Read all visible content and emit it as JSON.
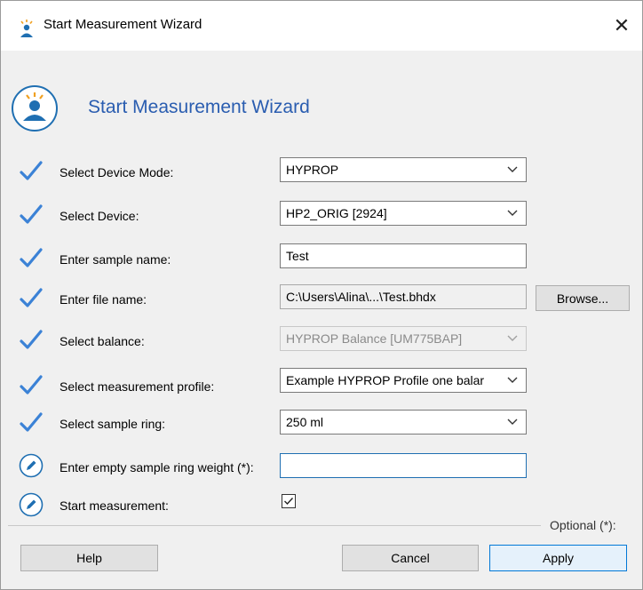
{
  "window": {
    "title": "Start Measurement Wizard",
    "close_glyph": "✕"
  },
  "header": {
    "title": "Start Measurement Wizard",
    "icon": "person-signal-icon"
  },
  "rows": [
    {
      "status": "done",
      "label": "Select Device Mode:",
      "type": "select",
      "value": "HYPROP"
    },
    {
      "status": "done",
      "label": "Select Device:",
      "type": "select",
      "value": "HP2_ORIG [2924]"
    },
    {
      "status": "done",
      "label": "Enter sample name:",
      "type": "text",
      "value": "Test"
    },
    {
      "status": "done",
      "label": "Enter file name:",
      "type": "text-readonly",
      "value": "C:\\Users\\Alina\\...\\Test.bhdx",
      "button": "Browse..."
    },
    {
      "status": "done",
      "label": "Select balance:",
      "type": "select-disabled",
      "value": "HYPROP Balance [UM775BAP]"
    },
    {
      "status": "done",
      "label": "Select measurement profile:",
      "type": "select",
      "value": "Example HYPROP Profile one balar"
    },
    {
      "status": "done",
      "label": "Select sample ring:",
      "type": "select",
      "value": "250 ml"
    },
    {
      "status": "edit",
      "label": "Enter empty sample ring weight (*):",
      "type": "text-focused",
      "value": ""
    },
    {
      "status": "edit",
      "label": "Start measurement:",
      "type": "checkbox",
      "checked": true
    }
  ],
  "footer": {
    "optional_note": "Optional (*):",
    "help": "Help",
    "cancel": "Cancel",
    "apply": "Apply"
  },
  "colors": {
    "accent": "#1f6fb2",
    "check": "#3b82d6",
    "title_blue": "#2a5db0"
  }
}
